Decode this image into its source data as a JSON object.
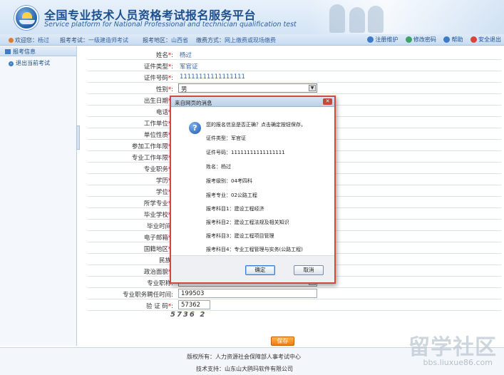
{
  "header": {
    "title_cn": "全国专业技术人员资格考试报名服务平台",
    "title_en": "Service platform for National Professional and technician qualification test"
  },
  "infobar": {
    "welcome_label": "欢迎您：",
    "welcome_user": "杨过",
    "exam_label": "报考考试：",
    "exam_value": "一级建造师考试",
    "region_label": "报考地区：",
    "region_value": "山西省",
    "pay_label": "缴费方式：",
    "pay_value": "网上缴费或现场缴费",
    "links": [
      "注册维护",
      "修改密码",
      "帮助",
      "安全退出"
    ]
  },
  "sidebar": {
    "heading": "报考信息",
    "items": [
      {
        "label": "退出当前考试"
      }
    ]
  },
  "form": {
    "fields": [
      {
        "label": "姓名",
        "value": "杨过"
      },
      {
        "label": "证件类型",
        "value": "军官证"
      },
      {
        "label": "证件号码",
        "value": "11111111111111111"
      },
      {
        "label": "性别",
        "value": "男"
      },
      {
        "label": "出生日期",
        "value": ""
      },
      {
        "label": "电话",
        "value": ""
      },
      {
        "label": "工作单位",
        "value": ""
      },
      {
        "label": "单位性质",
        "value": ""
      },
      {
        "label": "参加工作年限",
        "value": ""
      },
      {
        "label": "专业工作年限",
        "value": ""
      },
      {
        "label": "专业职务",
        "value": ""
      },
      {
        "label": "学历",
        "value": ""
      },
      {
        "label": "学位",
        "value": ""
      },
      {
        "label": "所学专业",
        "value": ""
      },
      {
        "label": "毕业学校",
        "value": ""
      },
      {
        "label": "毕业时间",
        "value": ""
      },
      {
        "label": "电子邮箱",
        "value": ""
      },
      {
        "label": "国籍地区",
        "value": ""
      },
      {
        "label": "民族",
        "value": ""
      },
      {
        "label": "政治面貌",
        "value": ""
      },
      {
        "label": "专业职称",
        "value": ""
      },
      {
        "label": "专业职务聘任时间",
        "value": "199503"
      },
      {
        "label": "验 证 码",
        "value": "57362"
      }
    ],
    "captcha_text": "5736 2",
    "save_label": "保存"
  },
  "dialog": {
    "title": "来自网页的消息",
    "lines": [
      "您的报名信息是否正确？点击确定按钮保存。",
      "证件类型：军官证",
      "证件号码：11111111111111111",
      "姓名：杨过",
      "报考级别：04考四科",
      "报考专业：02公路工程",
      "报考科目1：建设工程经济",
      "报考科目2：建设工程法规及相关知识",
      "报考科目3：建设工程项目管理",
      "报考科目4：专业工程管理与实务(公路工程)"
    ],
    "ok_label": "确定",
    "cancel_label": "取消"
  },
  "footer": {
    "copyright": "版权所有：人力资源社会保障部人事考试中心",
    "support": "技术支持：山东山大鸥玛软件有限公司"
  },
  "watermark": {
    "big": "留学社区",
    "small": "bbs.liuxue86.com"
  }
}
